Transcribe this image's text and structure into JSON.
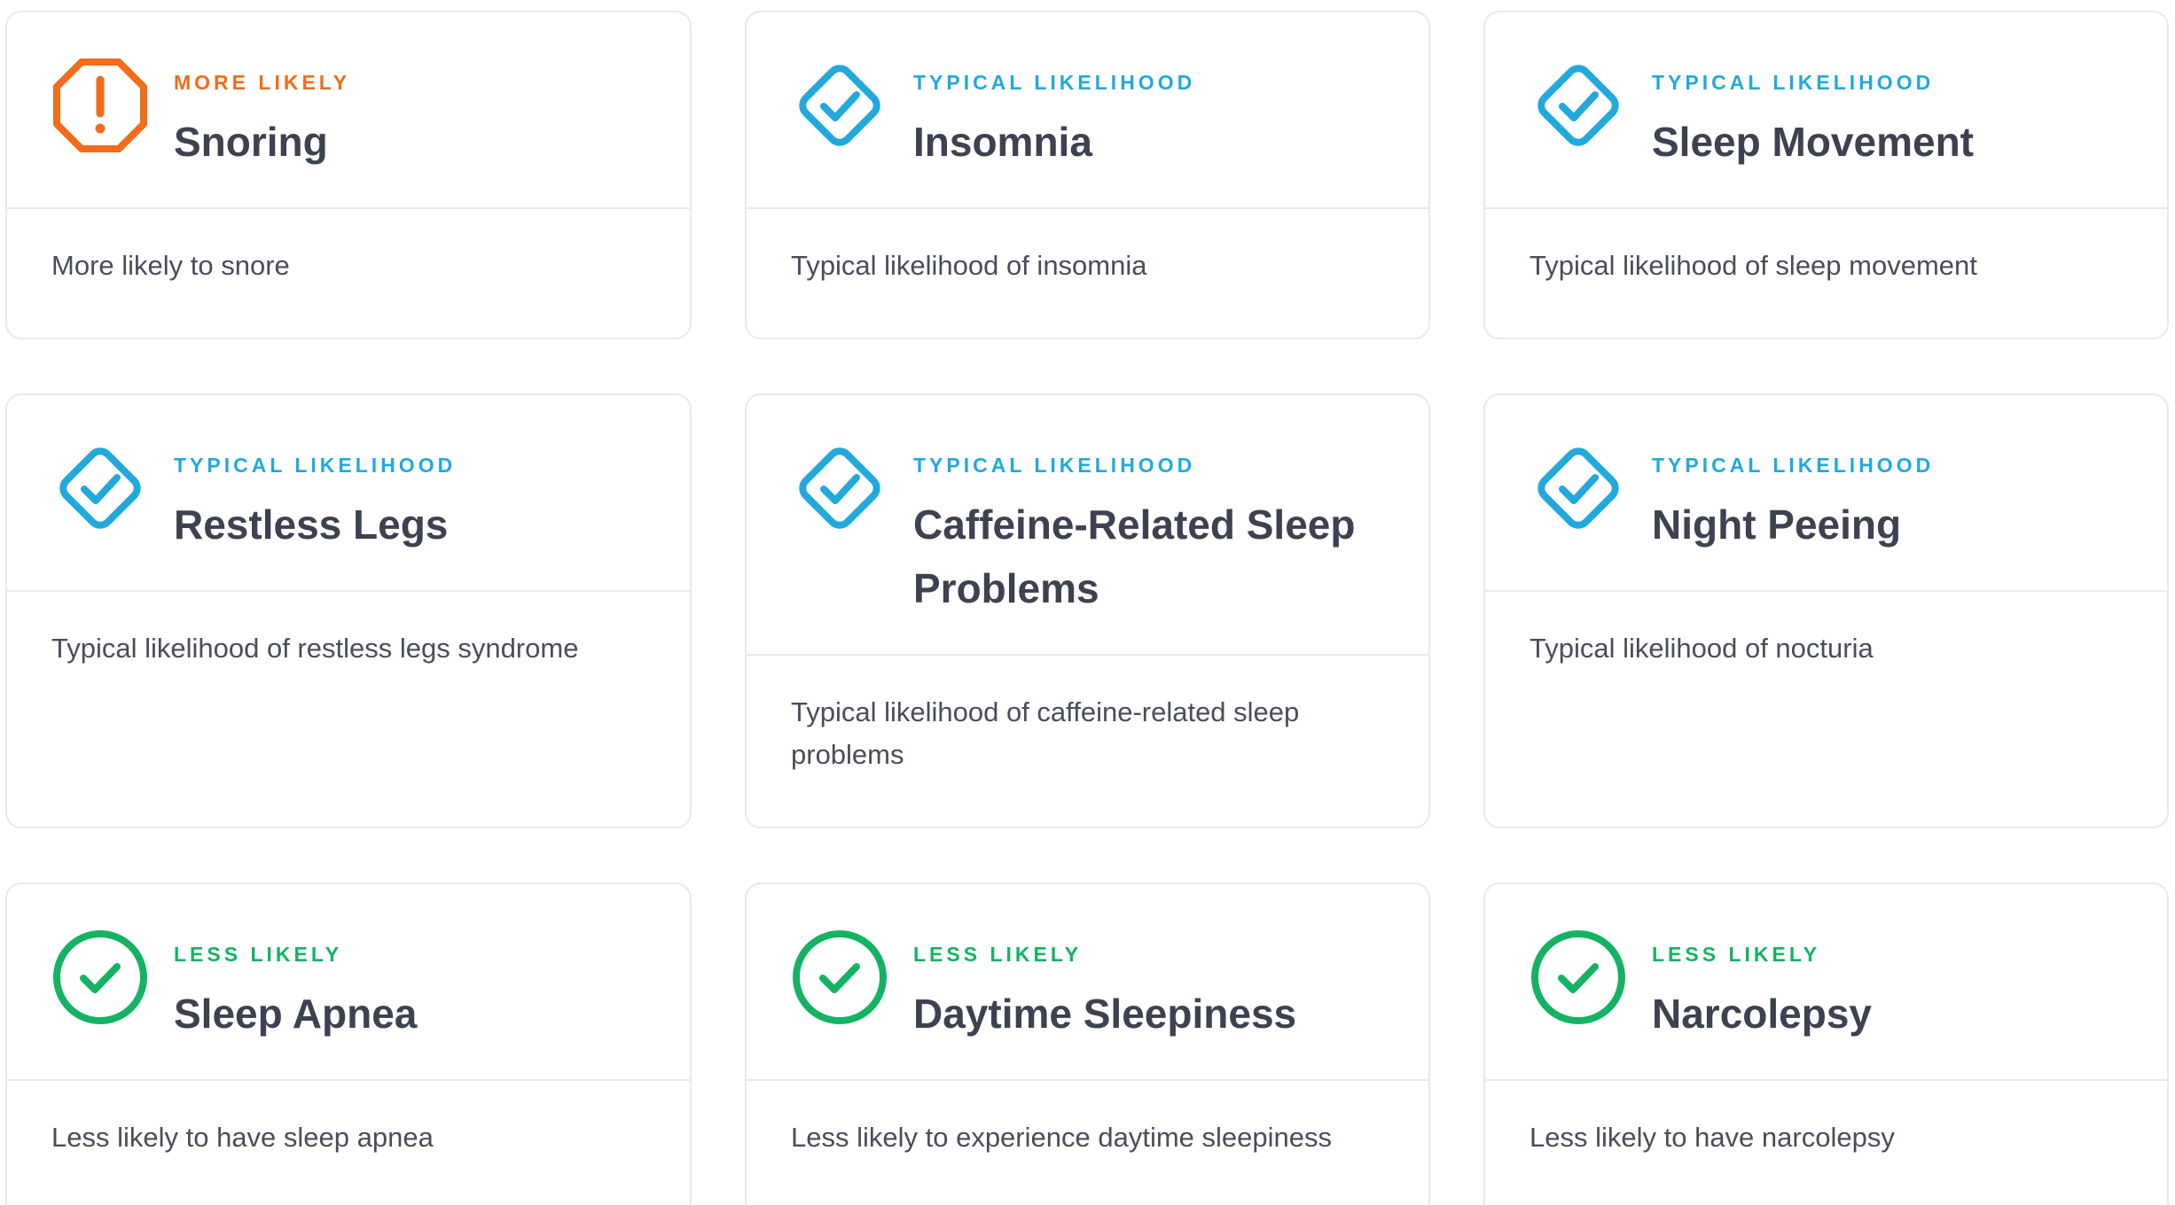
{
  "colors": {
    "more_likely": "#f26c1b",
    "typical": "#22a9dc",
    "less_likely": "#14b364",
    "title": "#3c4250",
    "text": "#484e5a",
    "border": "#e8e9ec"
  },
  "cards": [
    {
      "tag": "MORE LIKELY",
      "title": "Snoring",
      "description": "More likely to snore",
      "icon": "alert-octagon-icon"
    },
    {
      "tag": "TYPICAL LIKELIHOOD",
      "title": "Insomnia",
      "description": "Typical likelihood of insomnia",
      "icon": "check-diamond-icon"
    },
    {
      "tag": "TYPICAL LIKELIHOOD",
      "title": "Sleep Movement",
      "description": "Typical likelihood of sleep movement",
      "icon": "check-diamond-icon"
    },
    {
      "tag": "TYPICAL LIKELIHOOD",
      "title": "Restless Legs",
      "description": "Typical likelihood of restless legs syndrome",
      "icon": "check-diamond-icon"
    },
    {
      "tag": "TYPICAL LIKELIHOOD",
      "title": "Caffeine-Related Sleep Problems",
      "description": "Typical likelihood of caffeine-related sleep problems",
      "icon": "check-diamond-icon"
    },
    {
      "tag": "TYPICAL LIKELIHOOD",
      "title": "Night Peeing",
      "description": "Typical likelihood of nocturia",
      "icon": "check-diamond-icon"
    },
    {
      "tag": "LESS LIKELY",
      "title": "Sleep Apnea",
      "description": "Less likely to have sleep apnea",
      "icon": "check-circle-icon"
    },
    {
      "tag": "LESS LIKELY",
      "title": "Daytime Sleepiness",
      "description": "Less likely to experience daytime sleepiness",
      "icon": "check-circle-icon"
    },
    {
      "tag": "LESS LIKELY",
      "title": "Narcolepsy",
      "description": "Less likely to have narcolepsy",
      "icon": "check-circle-icon"
    }
  ]
}
